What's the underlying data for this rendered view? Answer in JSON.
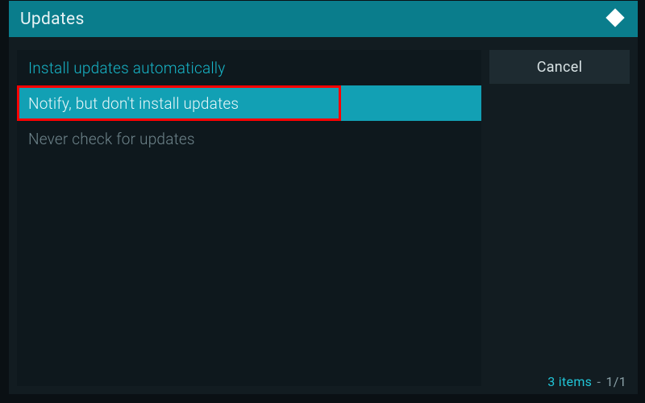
{
  "header": {
    "title": "Updates",
    "icon": "kodi-logo-icon"
  },
  "options": [
    {
      "label": "Install updates automatically",
      "name": "option-install-auto",
      "selected": false,
      "default": true
    },
    {
      "label": "Notify, but don't install updates",
      "name": "option-notify-only",
      "selected": true,
      "default": false
    },
    {
      "label": "Never check for updates",
      "name": "option-never-check",
      "selected": false,
      "default": false
    }
  ],
  "sidebar": {
    "cancel_label": "Cancel"
  },
  "footer": {
    "count_text": "3 items",
    "page_text": "1/1"
  },
  "highlight": {
    "target_index": 1
  }
}
